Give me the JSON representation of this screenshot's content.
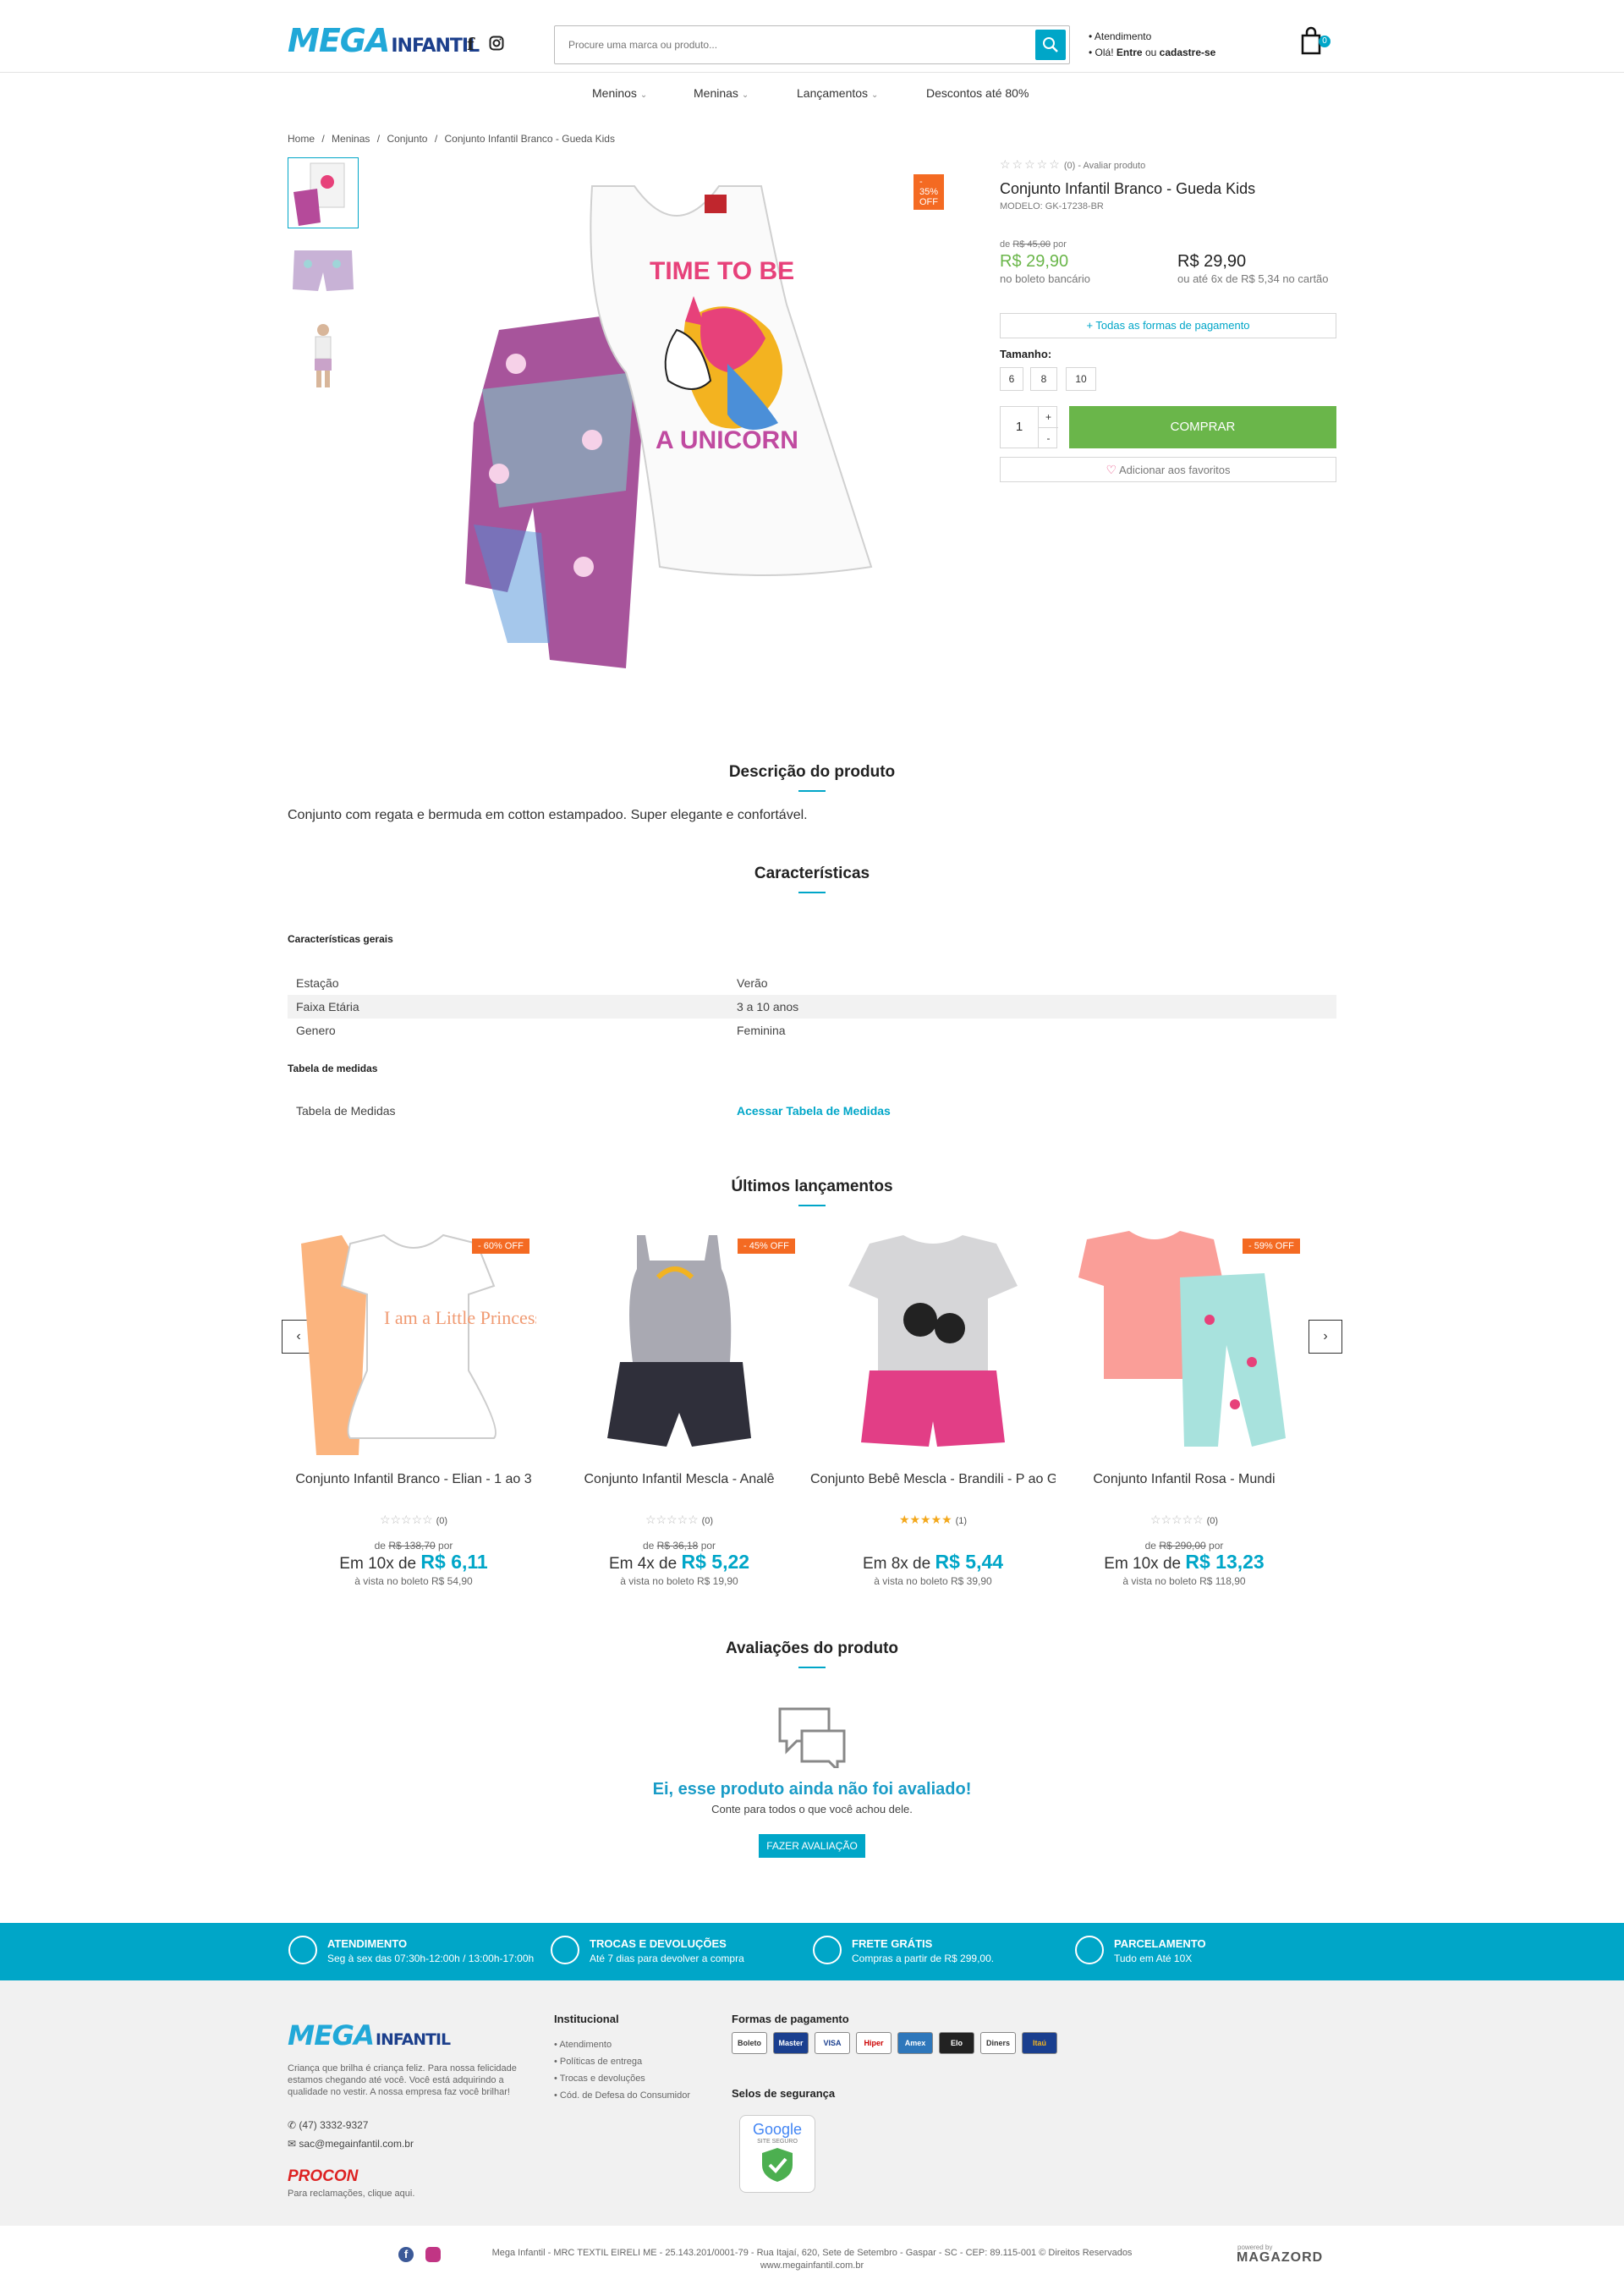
{
  "header": {
    "logo_main": "MEGA",
    "logo_sub": "INFANTIL",
    "search_placeholder": "Procure uma marca ou produto...",
    "atendimento": "Atendimento",
    "ola": "Olá!",
    "entre": "Entre",
    "ou": "ou",
    "cadastre": "cadastre-se",
    "cart_count": "0"
  },
  "nav": [
    "Meninos",
    "Meninas",
    "Lançamentos",
    "Descontos até 80%"
  ],
  "breadcrumb": [
    "Home",
    "Meninas",
    "Conjunto",
    "Conjunto Infantil Branco - Gueda Kids"
  ],
  "product": {
    "badge": "- 35% OFF",
    "rating_text": "(0) - Avaliar produto",
    "title": "Conjunto Infantil Branco - Gueda Kids",
    "model": "MODELO: GK-17238-BR",
    "old_price_prefix": "de",
    "old_price": "R$ 45,00",
    "old_price_suffix": "por",
    "price": "R$ 29,90",
    "price_note": "no boleto bancário",
    "price_card": "R$ 29,90",
    "price_card_note": "ou até 6x de R$ 5,34 no cartão",
    "payment_link": "+ Todas as formas de pagamento",
    "size_label": "Tamanho:",
    "sizes": [
      "6",
      "8",
      "10"
    ],
    "qty": "1",
    "plus": "+",
    "minus": "-",
    "buy": "COMPRAR",
    "favorite": "Adicionar aos favoritos",
    "graphic_text_1": "TIME TO BE",
    "graphic_text_2": "A UNICORN"
  },
  "description": {
    "title": "Descrição do produto",
    "text": "Conjunto com regata e bermuda em cotton estampadoo. Super elegante e confortável."
  },
  "features": {
    "title": "Características",
    "general_label": "Características gerais",
    "rows": [
      {
        "k": "Estação",
        "v": "Verão"
      },
      {
        "k": "Faixa Etária",
        "v": "3 a 10 anos"
      },
      {
        "k": "Genero",
        "v": "Feminina"
      }
    ],
    "measures_label": "Tabela de medidas",
    "measures_key": "Tabela de Medidas",
    "measures_link": "Acessar Tabela de Medidas"
  },
  "launches": {
    "title": "Últimos lançamentos",
    "items": [
      {
        "name": "Conjunto Infantil Branco - Elian - 1 ao 3",
        "badge": "- 60% OFF",
        "count": "(0)",
        "old": "R$ 138,70",
        "inst_prefix": "Em 10x de",
        "inst": "R$ 6,11",
        "cash": "à vista no boleto R$ 54,90",
        "graphic": "I am a Little Princess",
        "rated": false
      },
      {
        "name": "Conjunto Infantil Mescla - Analê",
        "badge": "- 45% OFF",
        "count": "(0)",
        "old": "R$ 36,18",
        "inst_prefix": "Em 4x de",
        "inst": "R$ 5,22",
        "cash": "à vista no boleto R$ 19,90",
        "graphic": "",
        "rated": false
      },
      {
        "name": "Conjunto Bebê Mescla - Brandili - P ao G",
        "badge": "",
        "count": "(1)",
        "old": "",
        "inst_prefix": "Em 8x de",
        "inst": "R$ 5,44",
        "cash": "à vista no boleto R$ 39,90",
        "graphic": "",
        "rated": true
      },
      {
        "name": "Conjunto Infantil Rosa - Mundi",
        "badge": "- 59% OFF",
        "count": "(0)",
        "old": "R$ 290,00",
        "inst_prefix": "Em 10x de",
        "inst": "R$ 13,23",
        "cash": "à vista no boleto R$ 118,90",
        "graphic": "",
        "rated": false
      }
    ],
    "old_prefix": "de",
    "old_suffix": "por"
  },
  "reviews": {
    "title": "Avaliações do produto",
    "headline": "Ei, esse produto ainda não foi avaliado!",
    "sub": "Conte para todos o que você achou dele.",
    "button": "FAZER AVALIAÇÃO"
  },
  "benefits": [
    {
      "title": "ATENDIMENTO",
      "sub": "Seg à sex das 07:30h-12:00h / 13:00h-17:00h"
    },
    {
      "title": "TROCAS E DEVOLUÇÕES",
      "sub": "Até 7 dias para devolver a compra"
    },
    {
      "title": "FRETE GRÁTIS",
      "sub": "Compras a partir de R$ 299,00."
    },
    {
      "title": "PARCELAMENTO",
      "sub": "Tudo em Até 10X"
    }
  ],
  "footer": {
    "about": "Criança que brilha é criança feliz. Para nossa felicidade estamos chegando até você. Você está adquirindo a qualidade no vestir. A nossa empresa faz você brilhar!",
    "phone": "(47) 3332-9327",
    "email": "sac@megainfantil.com.br",
    "procon": "PROCON",
    "procon_note": "Para reclamações, clique aqui.",
    "inst_title": "Institucional",
    "inst_links": [
      "Atendimento",
      "Políticas de entrega",
      "Trocas e devoluções",
      "Cód. de Defesa do Consumidor"
    ],
    "pay_title": "Formas de pagamento",
    "pay_methods": [
      "Boleto",
      "Master",
      "VISA",
      "Hiper",
      "Amex",
      "Elo",
      "Diners",
      "Itaú"
    ],
    "seal_title": "Selos de segurança",
    "seal_google": "Google",
    "seal_text": "SITE SEGURO",
    "copyright": "Mega Infantil - MRC TEXTIL EIRELI ME - 25.143.201/0001-79 - Rua Itajaí, 620, Sete de Setembro - Gaspar - SC - CEP: 89.115-001 © Direitos Reservados www.megainfantil.com.br",
    "powered": "powered by",
    "powered_brand": "MAGAZORD"
  },
  "colors": {
    "accent": "#00a6c8",
    "buy": "#6ab64a",
    "badge": "#f46a22",
    "benefits_bg": "#00a6c8"
  }
}
